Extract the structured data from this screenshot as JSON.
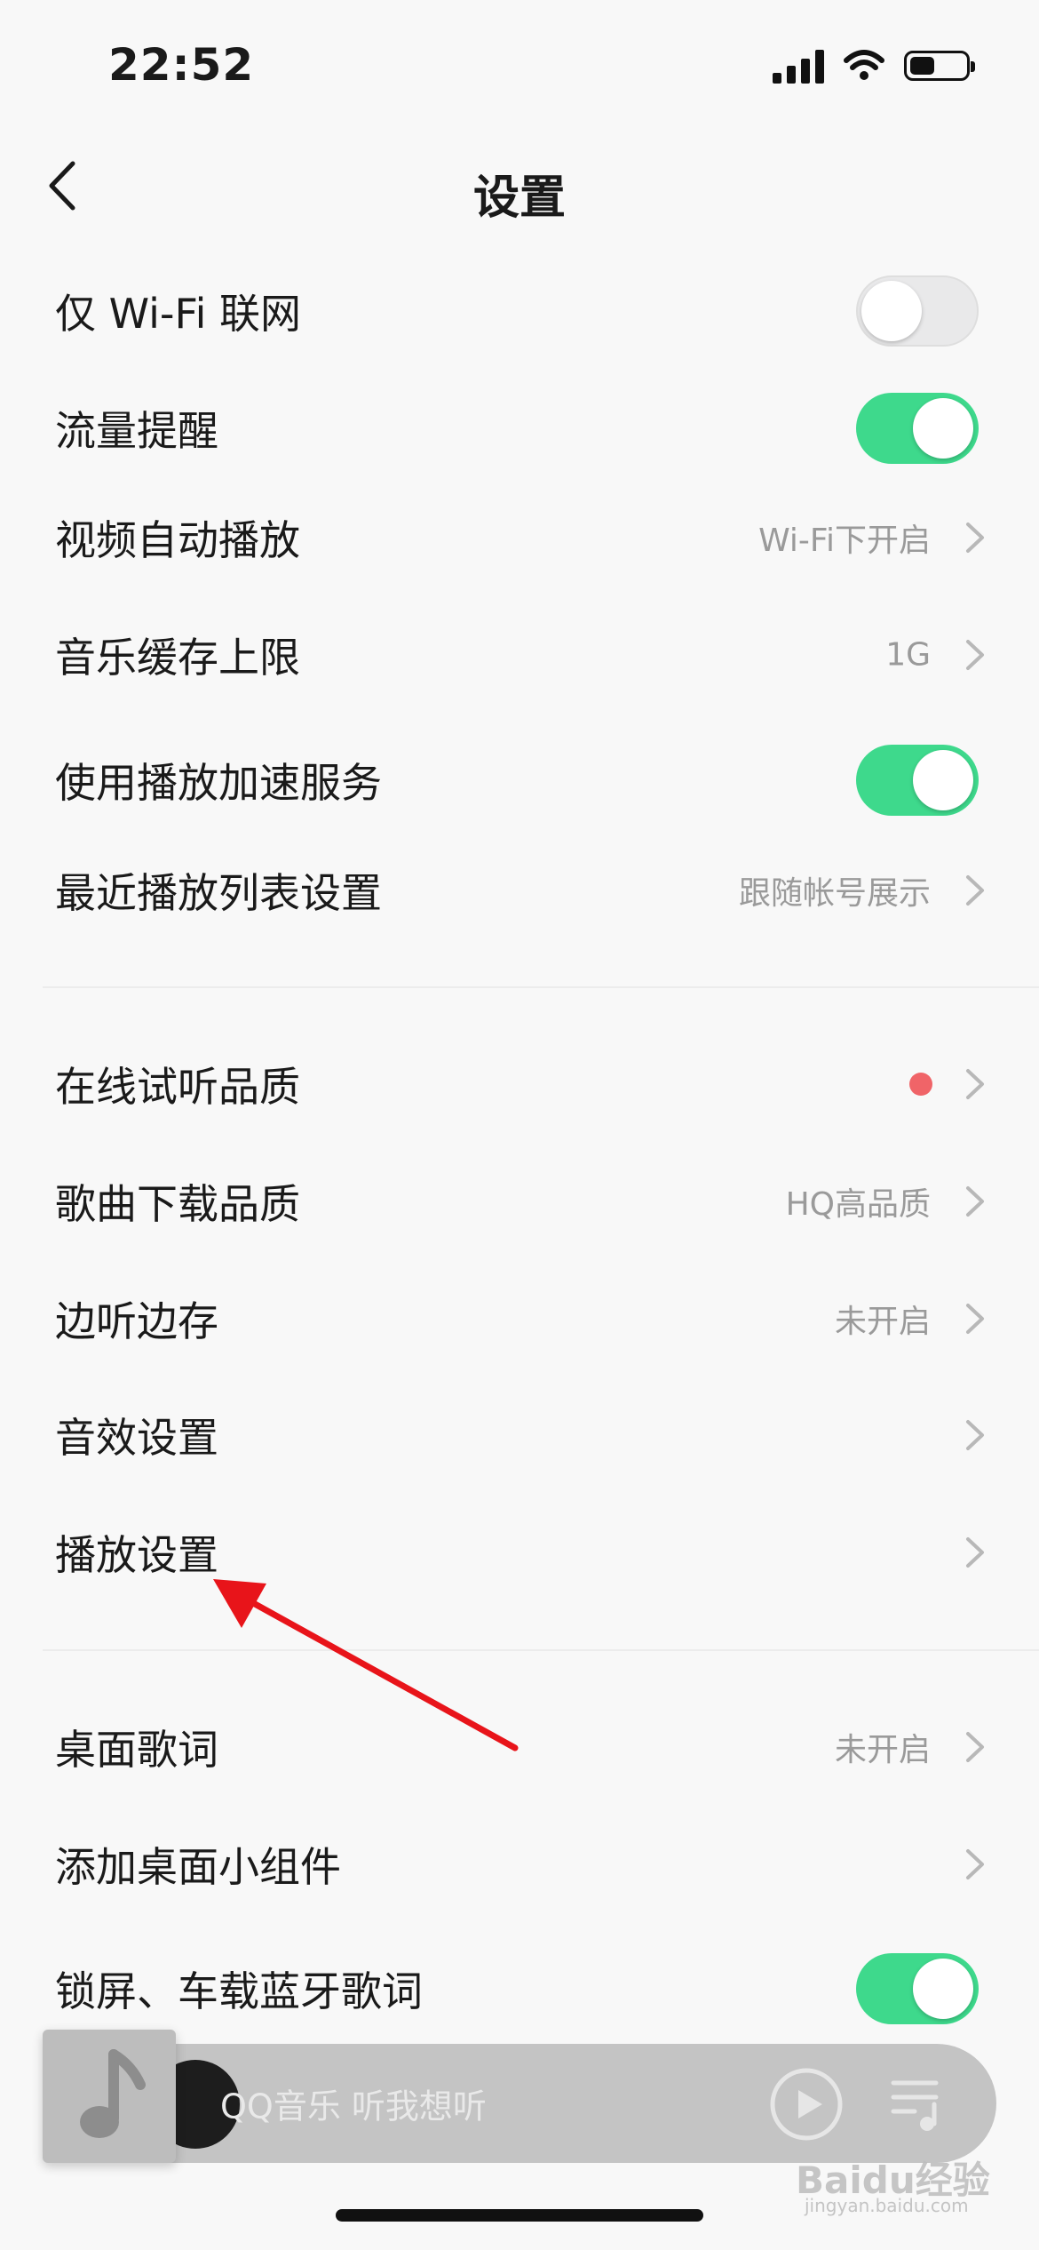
{
  "status_bar": {
    "time": "22:52",
    "battery_level": 0.45
  },
  "nav": {
    "title": "设置"
  },
  "section1": [
    {
      "label": "仅 Wi-Fi 联网",
      "toggle": "off"
    },
    {
      "label": "流量提醒",
      "toggle": "on"
    },
    {
      "label": "视频自动播放",
      "value": "Wi-Fi下开启"
    },
    {
      "label": "音乐缓存上限",
      "value": "1G"
    },
    {
      "label": "使用播放加速服务",
      "toggle": "on"
    },
    {
      "label": "最近播放列表设置",
      "value": "跟随帐号展示"
    }
  ],
  "section2": [
    {
      "label": "在线试听品质",
      "badge": "red-dot"
    },
    {
      "label": "歌曲下载品质",
      "value": "HQ高品质"
    },
    {
      "label": "边听边存",
      "value": "未开启"
    },
    {
      "label": "音效设置",
      "value": ""
    },
    {
      "label": "播放设置",
      "value": ""
    }
  ],
  "section3": [
    {
      "label": "桌面歌词",
      "value": "未开启"
    },
    {
      "label": "添加桌面小组件",
      "value": ""
    },
    {
      "label": "锁屏、车载蓝牙歌词",
      "toggle": "on"
    }
  ],
  "mini_player": {
    "text": "QQ音乐 听我想听"
  },
  "watermark": {
    "text": "Baidu经验",
    "sub": "jingyan.baidu.com"
  },
  "colors": {
    "toggle_on": "#3ed98c",
    "annotation_arrow": "#e8141a",
    "badge": "#f06468"
  }
}
